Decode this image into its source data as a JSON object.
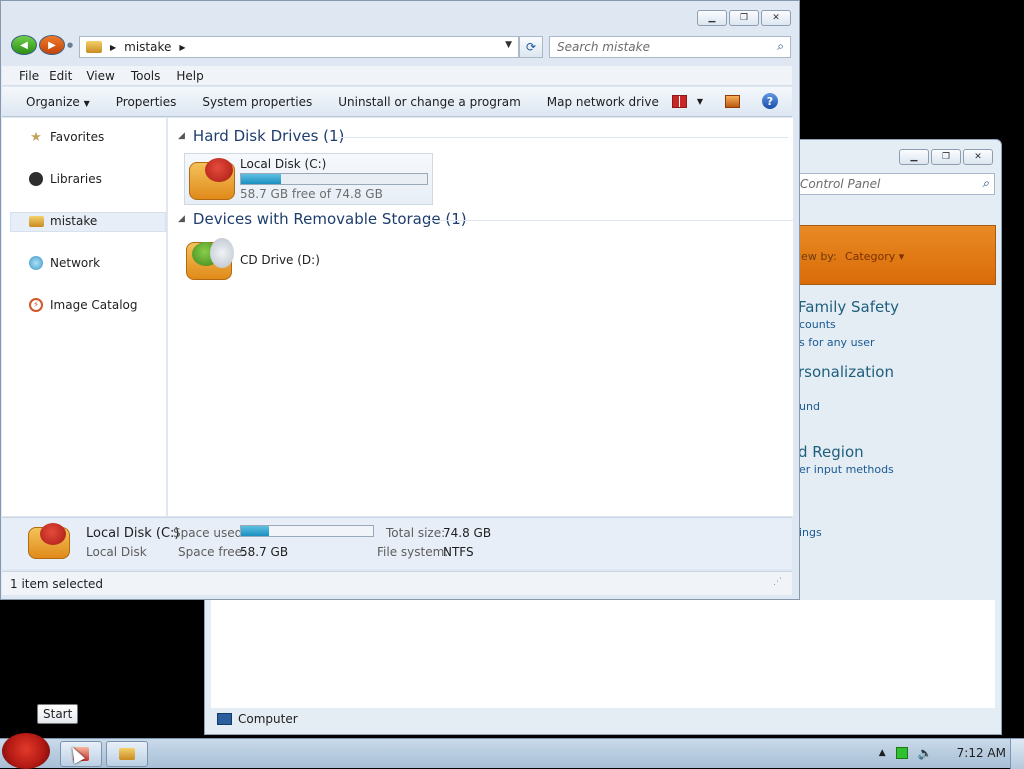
{
  "control_panel": {
    "search_placeholder": "Control Panel",
    "view_by_label": "iew by:",
    "view_by_value": "Category",
    "headings": [
      "Family Safety",
      "rsonalization",
      "d Region"
    ],
    "links": [
      "counts",
      "s for any user",
      "und",
      "er input methods",
      "ings"
    ],
    "status_text": "Computer"
  },
  "explorer": {
    "address": {
      "folder": "mistake"
    },
    "search_placeholder": "Search mistake",
    "menu": [
      "File",
      "Edit",
      "View",
      "Tools",
      "Help"
    ],
    "toolbar": {
      "organize": "Organize",
      "properties": "Properties",
      "system_properties": "System properties",
      "uninstall": "Uninstall or change a program",
      "map_drive": "Map network drive",
      "more": "»"
    },
    "sidebar": [
      {
        "label": "Favorites",
        "icon": "star-icon"
      },
      {
        "label": "Libraries",
        "icon": "library-icon"
      },
      {
        "label": "mistake",
        "icon": "computer-icon",
        "selected": true
      },
      {
        "label": "Network",
        "icon": "network-icon"
      },
      {
        "label": "Image Catalog",
        "icon": "catalog-icon"
      }
    ],
    "groups": {
      "hard_disk": "Hard Disk Drives (1)",
      "removable": "Devices with Removable Storage (1)"
    },
    "local_disk": {
      "name": "Local Disk (C:)",
      "free_text": "58.7 GB free of 74.8 GB",
      "used_fraction": 0.215
    },
    "cd_drive": {
      "name": "CD Drive (D:)"
    },
    "details": {
      "name": "Local Disk (C:)",
      "type": "Local Disk",
      "space_used_label": "Space used:",
      "space_free_label": "Space free:",
      "space_free": "58.7 GB",
      "total_size_label": "Total size:",
      "total_size": "74.8 GB",
      "file_system_label": "File system:",
      "file_system": "NTFS"
    },
    "status": "1 item selected"
  },
  "taskbar": {
    "tooltip": "Start",
    "clock": "7:12 AM"
  },
  "colors": {
    "accent": "#1a8fc0",
    "banner": "#e07a14",
    "link": "#1a5a92"
  }
}
